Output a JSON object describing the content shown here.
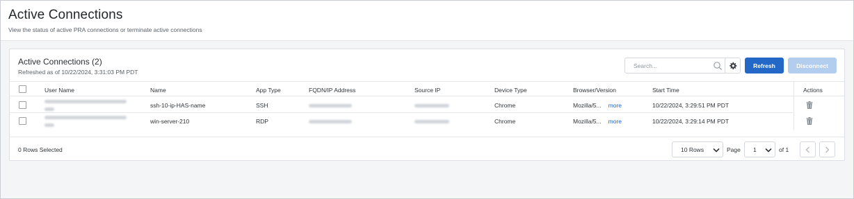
{
  "page": {
    "title": "Active Connections",
    "subtitle": "View the status of active PRA connections or terminate active connections"
  },
  "card": {
    "title": "Active Connections (2)",
    "refreshed": "Refreshed as of 10/22/2024, 3:31:03 PM PDT"
  },
  "toolbar": {
    "search_placeholder": "Search...",
    "search_icon": "search-icon",
    "settings_icon": "gear-icon",
    "refresh_label": "Refresh",
    "disconnect_label": "Disconnect"
  },
  "table": {
    "columns": [
      "User Name",
      "Name",
      "App Type",
      "FQDN/IP Address",
      "Source IP",
      "Device Type",
      "Browser/Version",
      "Start Time",
      "Actions"
    ],
    "rows": [
      {
        "name": "ssh-10-ip-HAS-name",
        "app_type": "SSH",
        "device_type": "Chrome",
        "browser": "Mozilla/5...",
        "more": "more",
        "start_time": "10/22/2024, 3:29:51 PM PDT"
      },
      {
        "name": "win-server-210",
        "app_type": "RDP",
        "device_type": "Chrome",
        "browser": "Mozilla/5...",
        "more": "more",
        "start_time": "10/22/2024, 3:29:14 PM PDT"
      }
    ]
  },
  "footer": {
    "selected": "0 Rows Selected",
    "rows_per_page": "10 Rows",
    "page_label": "Page",
    "page_value": "1",
    "of_label": "of 1"
  },
  "colors": {
    "accent": "#2468c7",
    "disabled_button": "#b3cdef",
    "border": "#dcdfe3"
  }
}
